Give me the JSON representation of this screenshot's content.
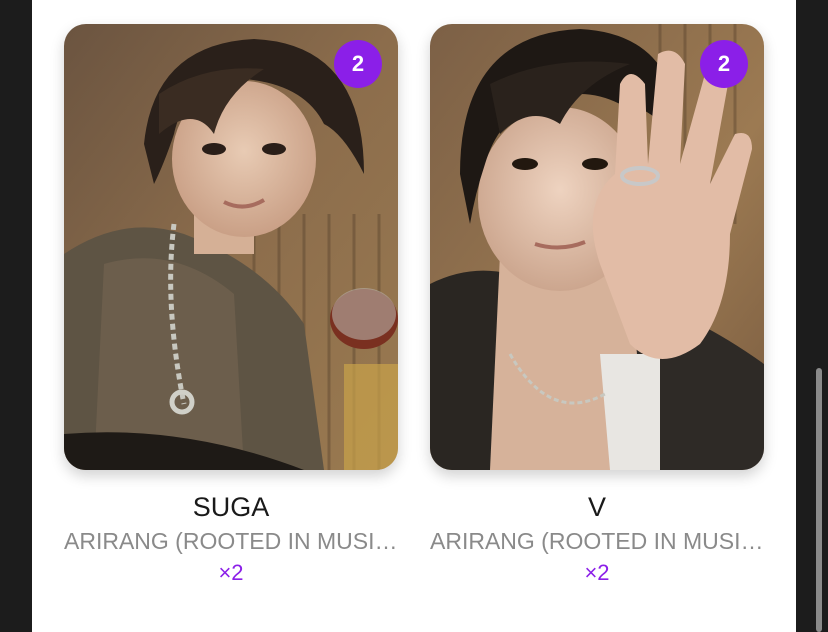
{
  "cards": [
    {
      "name": "SUGA",
      "album": "ARIRANG (ROOTED IN MUSIC...",
      "badge": "2",
      "quantity": "×2"
    },
    {
      "name": "V",
      "album": "ARIRANG (ROOTED IN MUSIC...",
      "badge": "2",
      "quantity": "×2"
    }
  ],
  "colors": {
    "accent": "#8b1fe8",
    "background": "#1c1c1c",
    "panel": "#ffffff"
  }
}
